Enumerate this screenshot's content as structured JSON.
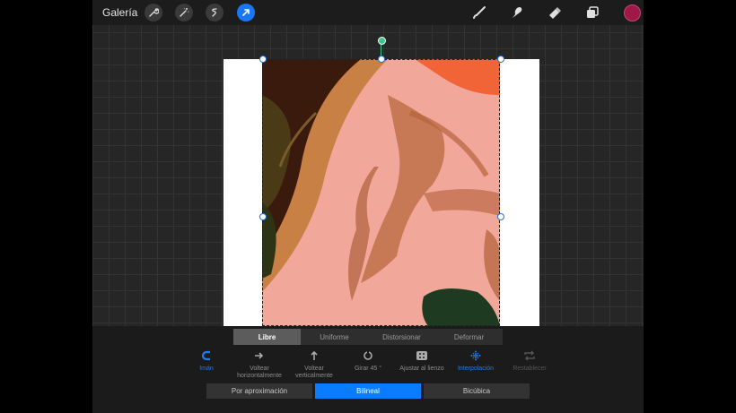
{
  "topbar": {
    "gallery_label": "Galería",
    "tools": [
      {
        "name": "wrench-icon"
      },
      {
        "name": "magic-wand-icon"
      },
      {
        "name": "selection-icon"
      },
      {
        "name": "transform-arrow-icon",
        "active": true
      }
    ],
    "right_tools": [
      "brush-icon",
      "smudge-icon",
      "eraser-icon",
      "layers-icon"
    ],
    "current_color": "#a01848"
  },
  "transform_modes": [
    "Libre",
    "Uniforme",
    "Distorsionar",
    "Deformar"
  ],
  "active_mode": "Libre",
  "options": {
    "iman": "Imán",
    "flip_h": "Voltear horizontalmente",
    "flip_v": "Voltear verticalmente",
    "rotate": "Girar 45 °",
    "fit": "Ajustar al lienzo",
    "interpolation": "Interpolación",
    "reset": "Restablecer"
  },
  "interpolation_modes": [
    "Por aproximación",
    "Bilineal",
    "Bicúbica"
  ],
  "active_interpolation": "Bilineal",
  "colors": {
    "accent": "#1877f2",
    "canvas_bg": "#ffffff",
    "photo_bg": "#f2a79b",
    "swatch": "#a01848"
  }
}
